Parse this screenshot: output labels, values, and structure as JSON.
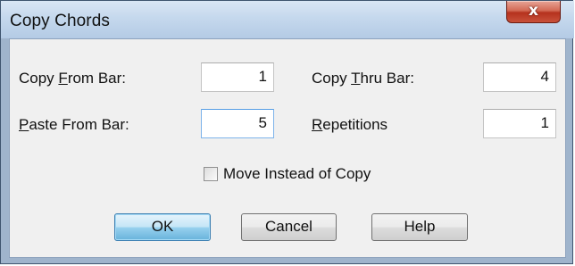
{
  "window": {
    "title": "Copy Chords",
    "close_glyph": "x"
  },
  "fields": {
    "copy_from_bar": {
      "label_pre": "Copy ",
      "label_mnemonic": "F",
      "label_post": "rom Bar:",
      "value": "1"
    },
    "copy_thru_bar": {
      "label_pre": "Copy ",
      "label_mnemonic": "T",
      "label_post": "hru Bar:",
      "value": "4"
    },
    "paste_from_bar": {
      "label_pre": "",
      "label_mnemonic": "P",
      "label_post": "aste From Bar:",
      "value": "5"
    },
    "repetitions": {
      "label_pre": "",
      "label_mnemonic": "R",
      "label_post": "epetitions",
      "value": "1"
    }
  },
  "move_instead_of_copy": {
    "label": "Move Instead of Copy",
    "checked": false
  },
  "buttons": {
    "ok": "OK",
    "cancel": "Cancel",
    "help": "Help"
  }
}
